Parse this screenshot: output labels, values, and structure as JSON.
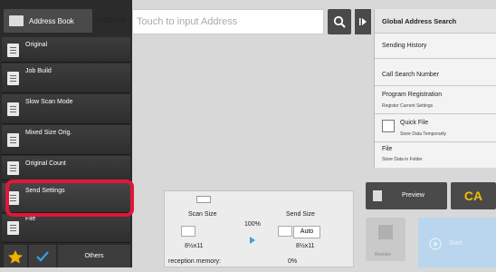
{
  "top": {
    "address_book": "Address Book",
    "address_label": "Address",
    "address_placeholder": "Touch to input Address"
  },
  "left_menu": [
    {
      "label": "Original"
    },
    {
      "label": "Job Build"
    },
    {
      "label": "Slow Scan Mode"
    },
    {
      "label": "Mixed Size Orig."
    },
    {
      "label": "Original Count"
    },
    {
      "label": "Send Settings"
    },
    {
      "label": "File"
    }
  ],
  "right_panel": {
    "global_search": "Global Address Search",
    "sending_history": "Sending History",
    "call_search_number": "Call Search Number",
    "program_registration": "Program Registration",
    "program_registration_sub": "Register Current Settings",
    "quick_file": "Quick File",
    "quick_file_sub": "Store Data Temporarily",
    "file": "File",
    "file_sub": "Store Data in Folder"
  },
  "scan_info": {
    "scan_size_label": "Scan Size",
    "send_size_label": "Send Size",
    "ratio": "100%",
    "send_size_value": "Auto",
    "scan_paper": "8½x11",
    "send_paper": "8½x11",
    "memory_label": "reception memory:",
    "memory_value": "0%"
  },
  "actions": {
    "preview": "Preview",
    "ca": "CA",
    "resolve": "Resolve",
    "start": "Start"
  },
  "bottom": {
    "others": "Others"
  },
  "colors": {
    "highlight": "#e0173a",
    "ca_text": "#f0c000",
    "star": "#f0b000",
    "check": "#3aa0e0"
  }
}
